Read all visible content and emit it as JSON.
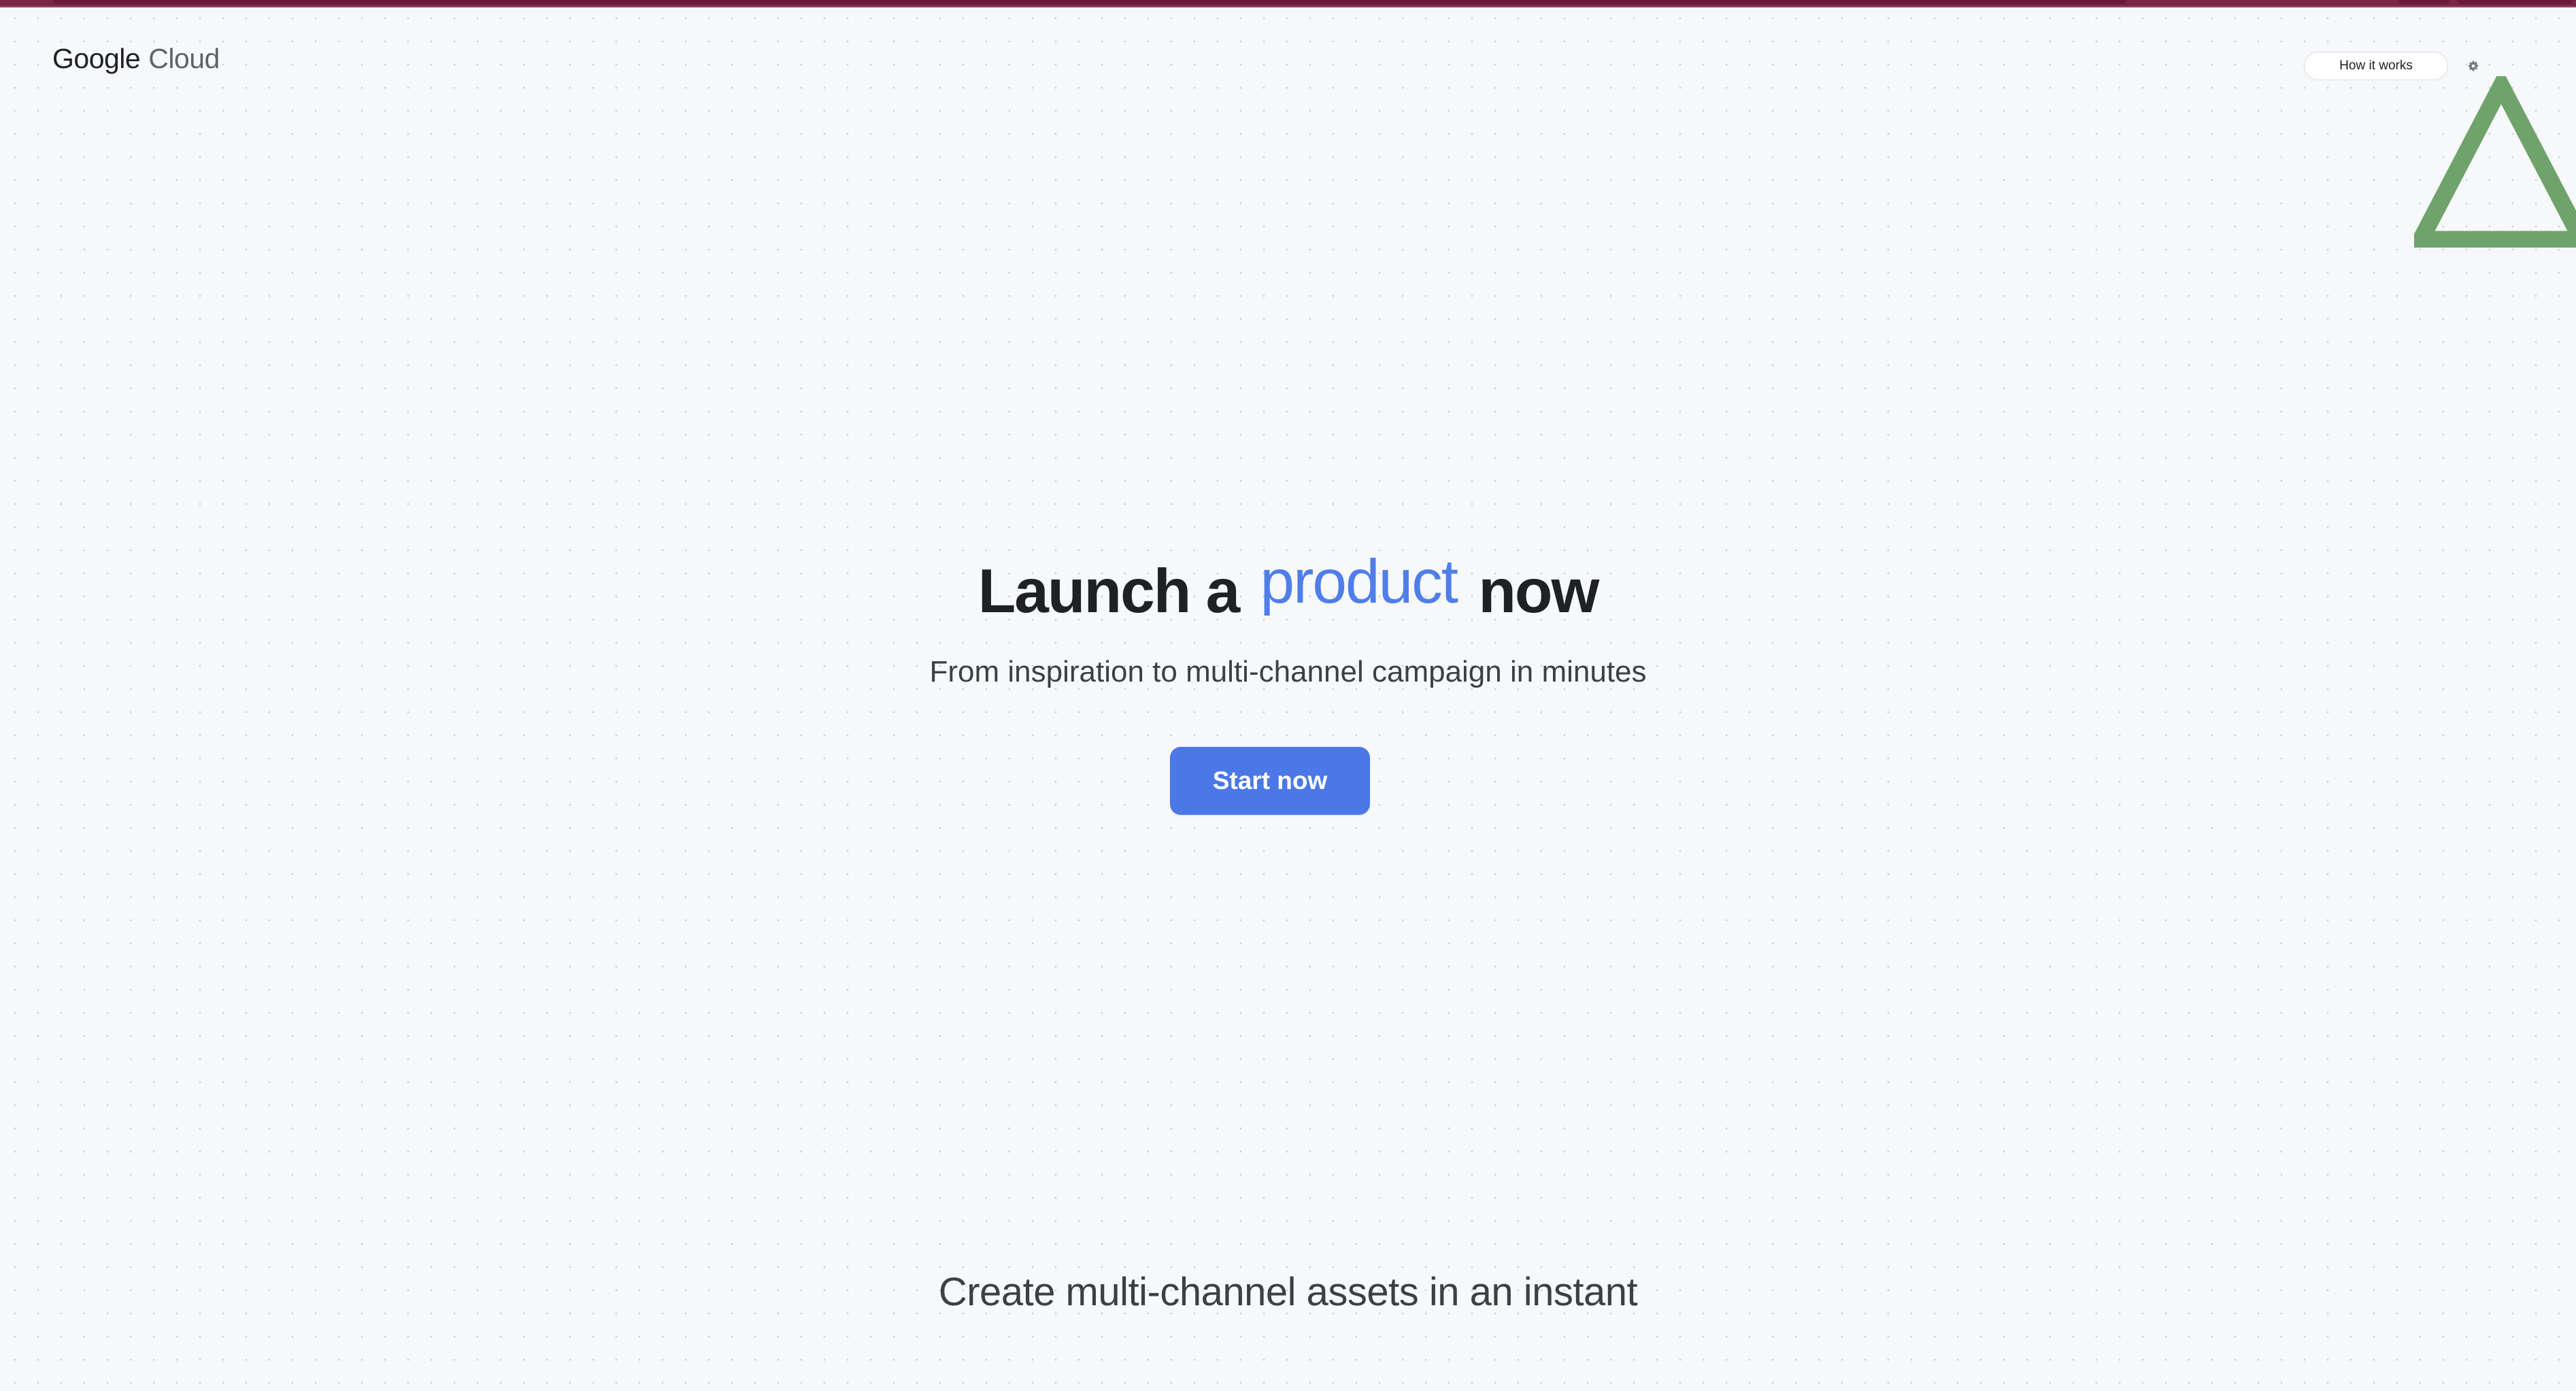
{
  "brand": {
    "google": "Google",
    "cloud": "Cloud"
  },
  "header": {
    "how_it_works": "How it works",
    "settings_icon": "gear-icon"
  },
  "hero": {
    "title_before": "Launch a",
    "title_highlight": "product",
    "title_after": "now",
    "subtitle": "From inspiration to multi-channel campaign in minutes",
    "cta": "Start now"
  },
  "section": {
    "title": "Create multi-channel assets in an instant"
  },
  "colors": {
    "accent": "#4a78e7",
    "highlight_text": "#4f7ee9",
    "top_strip": "#7b2645",
    "triangle": "#6fa36b"
  },
  "decoration": {
    "triangle_icon": "triangle-icon"
  }
}
